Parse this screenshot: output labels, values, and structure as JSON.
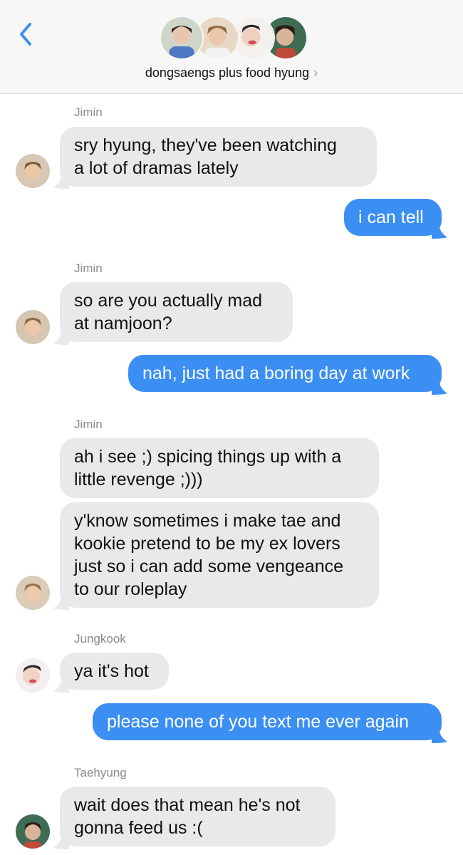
{
  "header": {
    "group_name": "dongsaengs plus food hyung",
    "chevron": "›",
    "back_icon": "chevron-left-icon",
    "accent": "#3b8ff2"
  },
  "messages": [
    {
      "sender": "Jimin"
    },
    {
      "text": "sry hyung, they've been watching\na lot of dramas lately"
    },
    {
      "text": "i can tell"
    },
    {
      "sender": "Jimin"
    },
    {
      "text": "so are you actually mad\nat namjoon?"
    },
    {
      "text": "nah, just had a boring day at work"
    },
    {
      "sender": "Jimin"
    },
    {
      "text": "ah i see ;) spicing things up with a\nlittle revenge ;)))"
    },
    {
      "text": "y'know sometimes i make tae and\nkookie pretend to be my ex lovers\njust so i can add some vengeance\nto our roleplay"
    },
    {
      "sender": "Jungkook"
    },
    {
      "text": "ya it's hot"
    },
    {
      "text": "please none of you text me ever again"
    },
    {
      "sender": "Taehyung"
    },
    {
      "text": "wait does that mean he's not\ngonna feed us :("
    }
  ],
  "colors": {
    "incoming_bubble": "#e9e9eb",
    "outgoing_bubble": "#3b8ff2",
    "sender_label": "#8a8a8e"
  }
}
